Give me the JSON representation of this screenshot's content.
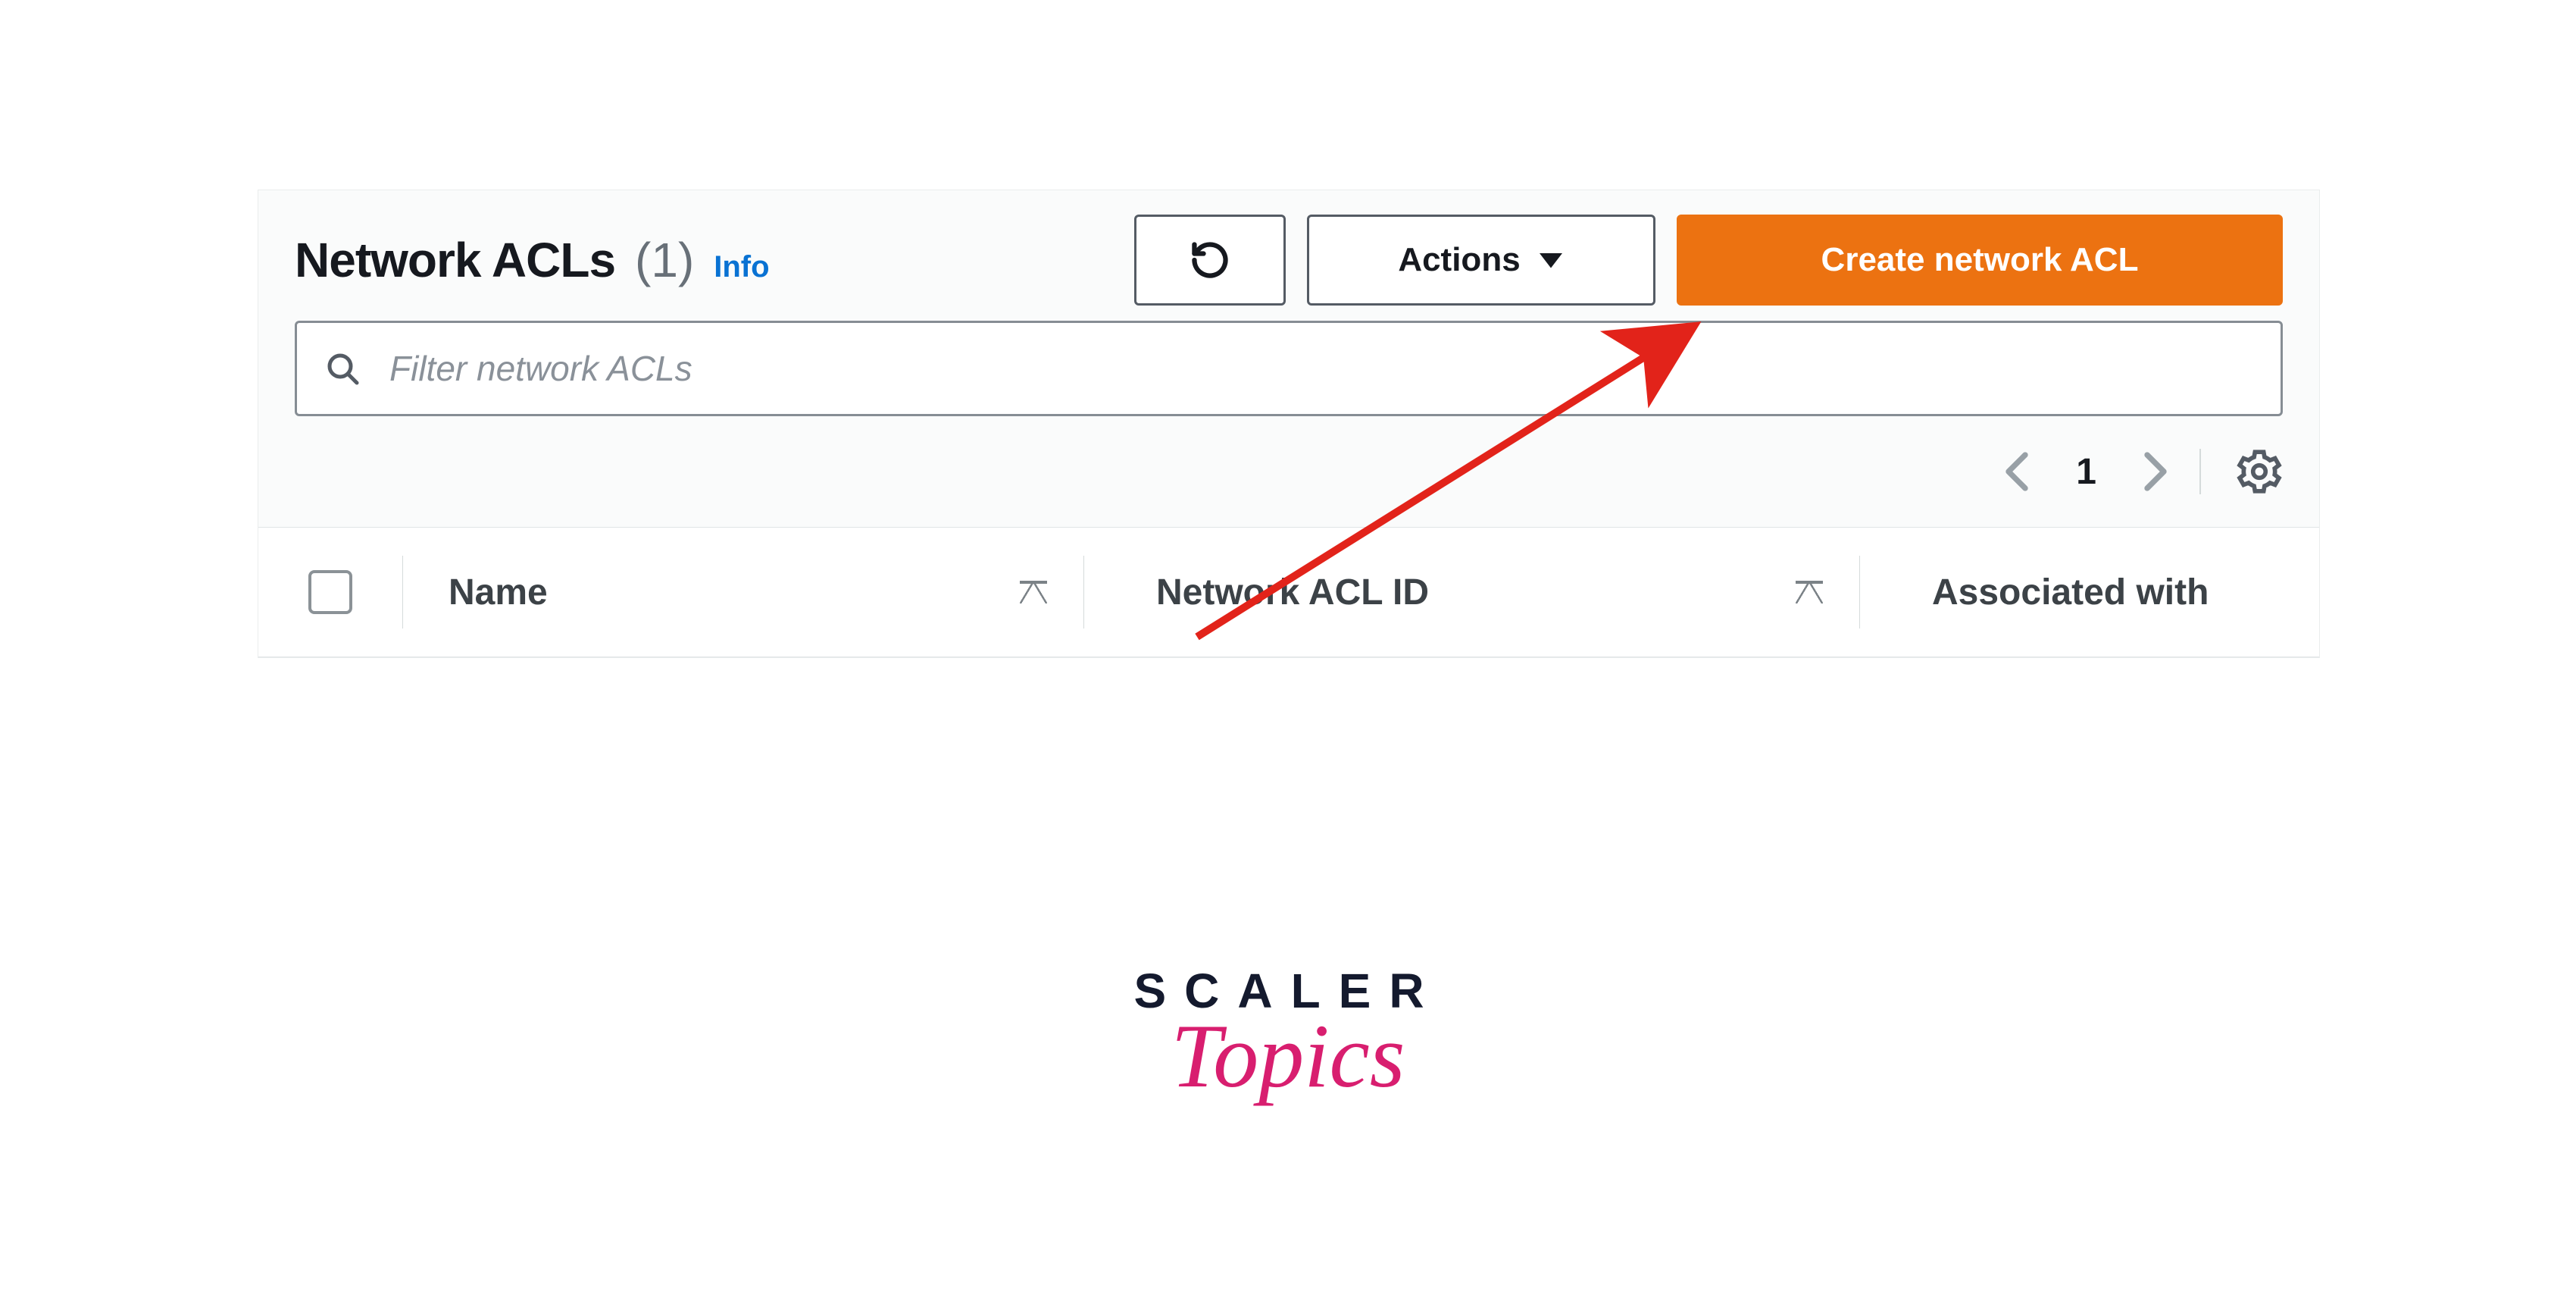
{
  "header": {
    "title": "Network ACLs",
    "count": "(1)",
    "info_label": "Info",
    "actions_label": "Actions",
    "create_label": "Create network ACL"
  },
  "filter": {
    "placeholder": "Filter network ACLs"
  },
  "pagination": {
    "page": "1"
  },
  "table": {
    "columns": {
      "name": "Name",
      "acl_id": "Network ACL ID",
      "associated": "Associated with"
    }
  },
  "watermark": {
    "line1": "SCALER",
    "line2": "Topics"
  }
}
